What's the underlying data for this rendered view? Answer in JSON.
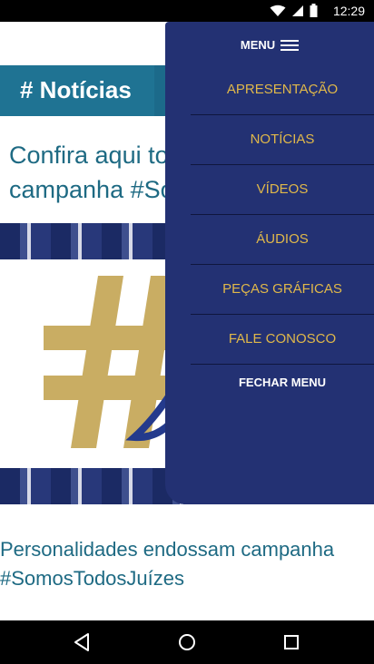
{
  "status_bar": {
    "time": "12:29",
    "icons": [
      "wifi-icon",
      "signal-icon",
      "battery-icon"
    ]
  },
  "page": {
    "section_title": "# Notícias",
    "intro_text_line1": "Confira aqui tod",
    "intro_text_line2": "campanha #Sor",
    "article_title_line1": "Personalidades endossam campanha",
    "article_title_line2": "#SomosTodosJuízes"
  },
  "drawer": {
    "header_label": "MENU",
    "items": [
      {
        "label": "APRESENTAÇÃO"
      },
      {
        "label": "NOTÍCIAS"
      },
      {
        "label": "VÍDEOS"
      },
      {
        "label": "ÁUDIOS"
      },
      {
        "label": "PEÇAS GRÁFICAS"
      },
      {
        "label": "FALE CONOSCO"
      }
    ],
    "close_label": "FECHAR MENU"
  },
  "colors": {
    "drawer_bg": "#233173",
    "menu_text": "#e0b84a",
    "banner": "#1c6a8a",
    "link_text": "#1e6a83"
  }
}
